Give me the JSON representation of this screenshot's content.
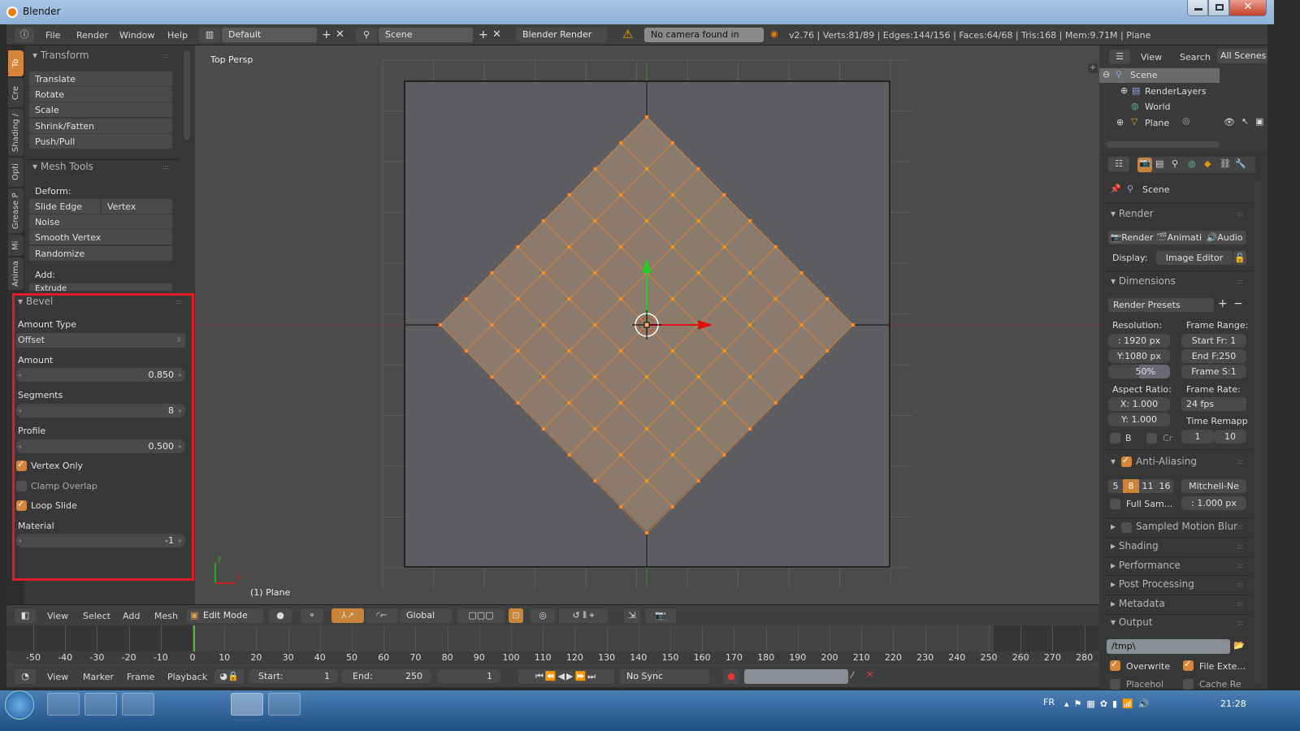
{
  "window": {
    "title": "Blender"
  },
  "infobar": {
    "menus": [
      "File",
      "Render",
      "Window",
      "Help"
    ],
    "screen_layout": "Default",
    "scene": "Scene",
    "render_engine": "Blender Render",
    "warning": "No camera found in scene",
    "stats": "v2.76 | Verts:81/89 | Edges:144/156 | Faces:64/68 | Tris:168 | Mem:9.71M | Plane"
  },
  "toolshelf": {
    "tabs": [
      "To",
      "Cre",
      "Shading /",
      "Opti",
      "Grease P",
      "Mi",
      "Anima"
    ],
    "transform": {
      "title": "Transform",
      "buttons": [
        "Translate",
        "Rotate",
        "Scale",
        "Shrink/Fatten",
        "Push/Pull"
      ]
    },
    "mesh_tools": {
      "title": "Mesh Tools",
      "deform_label": "Deform:",
      "slide_edge": "Slide Edge",
      "vertex": "Vertex",
      "buttons": [
        "Noise",
        "Smooth Vertex",
        "Randomize"
      ],
      "add_label": "Add:",
      "extrude": "Extrude"
    },
    "bevel": {
      "title": "Bevel",
      "amount_type_label": "Amount Type",
      "amount_type_value": "Offset",
      "amount_label": "Amount",
      "amount_value": "0.850",
      "segments_label": "Segments",
      "segments_value": "8",
      "profile_label": "Profile",
      "profile_value": "0.500",
      "vertex_only": {
        "label": "Vertex Only",
        "checked": true
      },
      "clamp_overlap": {
        "label": "Clamp Overlap",
        "checked": false
      },
      "loop_slide": {
        "label": "Loop Slide",
        "checked": true
      },
      "material_label": "Material",
      "material_value": "-1"
    }
  },
  "viewport": {
    "view_label": "Top Persp",
    "object_label": "(1) Plane",
    "axis_x": "x",
    "axis_y": "y"
  },
  "view3d_header": {
    "menus": [
      "View",
      "Select",
      "Add",
      "Mesh"
    ],
    "mode": "Edit Mode",
    "orientation": "Global"
  },
  "timeline": {
    "ticks": [
      "-50",
      "-40",
      "-30",
      "-20",
      "-10",
      "0",
      "10",
      "20",
      "30",
      "40",
      "50",
      "60",
      "70",
      "80",
      "90",
      "100",
      "110",
      "120",
      "130",
      "140",
      "150",
      "160",
      "170",
      "180",
      "190",
      "200",
      "210",
      "220",
      "230",
      "240",
      "250",
      "260",
      "270",
      "280"
    ],
    "menus": [
      "View",
      "Marker",
      "Frame",
      "Playback"
    ],
    "start_label": "Start:",
    "start_value": "1",
    "end_label": "End:",
    "end_value": "250",
    "current_frame": "1",
    "sync": "No Sync"
  },
  "outliner": {
    "menus": [
      "View",
      "Search"
    ],
    "filter": "All Scenes",
    "items": [
      "Scene",
      "RenderLayers",
      "World",
      "Plane"
    ]
  },
  "properties": {
    "context": "Scene",
    "render": {
      "title": "Render",
      "render_btn": "Render",
      "anim_btn": "Animati",
      "audio_btn": "Audio",
      "display_label": "Display:",
      "display_value": "Image Editor"
    },
    "dimensions": {
      "title": "Dimensions",
      "presets": "Render Presets",
      "resolution_label": "Resolution:",
      "res_x": ": 1920 px",
      "res_y": "Y:1080 px",
      "res_pct": "50%",
      "frame_range_label": "Frame Range:",
      "start": "Start Fr: 1",
      "end": "End F:250",
      "step": "Frame S:1",
      "aspect_label": "Aspect Ratio:",
      "aspect_x": "X:  1.000",
      "aspect_y": "Y:  1.000",
      "frame_rate_label": "Frame Rate:",
      "frame_rate": "24 fps",
      "time_remap_label": "Time Remapp",
      "b_label": "B",
      "cr_label": "Cr",
      "remap_old": "1",
      "remap_new": "10"
    },
    "anti_aliasing": {
      "title": "Anti-Aliasing",
      "samples": [
        "5",
        "8",
        "11",
        "16"
      ],
      "selected": "8",
      "filter": "Mitchell-Ne",
      "full_sample": "Full Sam...",
      "filter_size": ": 1.000 px"
    },
    "collapsed": [
      "Sampled Motion Blur",
      "Shading",
      "Performance",
      "Post Processing",
      "Metadata"
    ],
    "output": {
      "title": "Output",
      "path": "/tmp\\",
      "overwrite": "Overwrite",
      "file_ext": "File Exte...",
      "placeholders": "Placehol",
      "cache": "Cache Re"
    }
  },
  "taskbar": {
    "lang": "FR",
    "clock": "21:28"
  },
  "colors": {
    "accent": "#d4873c",
    "highlight": "#e31b23",
    "mesh": "#8c7a6c",
    "vertex": "#ff8c1a"
  }
}
